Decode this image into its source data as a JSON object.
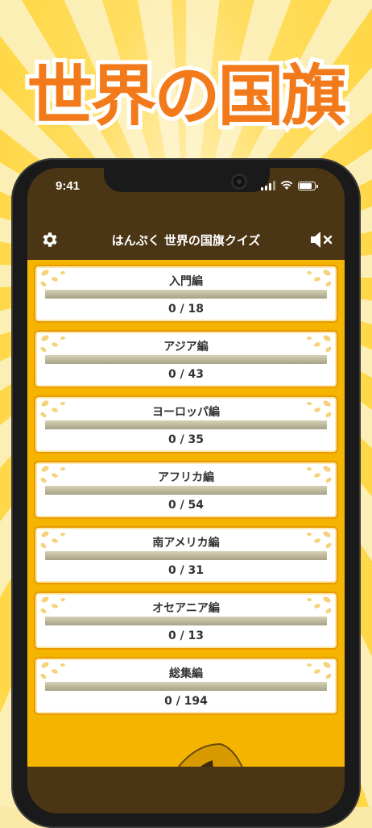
{
  "promo": {
    "headline": "世界の国旗"
  },
  "status_bar": {
    "time": "9:41"
  },
  "app_bar": {
    "title": "はんぷく 世界の国旗クイズ",
    "settings_icon": "gear-icon",
    "sound_icon": "speaker-mute-icon"
  },
  "categories": [
    {
      "label": "入門編",
      "progress_text": "0 / 18",
      "progress": 0
    },
    {
      "label": "アジア編",
      "progress_text": "0 / 43",
      "progress": 0
    },
    {
      "label": "ヨーロッパ編",
      "progress_text": "0 / 35",
      "progress": 0
    },
    {
      "label": "アフリカ編",
      "progress_text": "0 / 54",
      "progress": 0
    },
    {
      "label": "南アメリカ編",
      "progress_text": "0 / 31",
      "progress": 0
    },
    {
      "label": "オセアニア編",
      "progress_text": "0 / 13",
      "progress": 0
    },
    {
      "label": "総集編",
      "progress_text": "0 / 194",
      "progress": 0
    }
  ],
  "colors": {
    "accent": "#F27A1A",
    "list_background": "#F4B400",
    "app_bar": "#4A3514"
  }
}
